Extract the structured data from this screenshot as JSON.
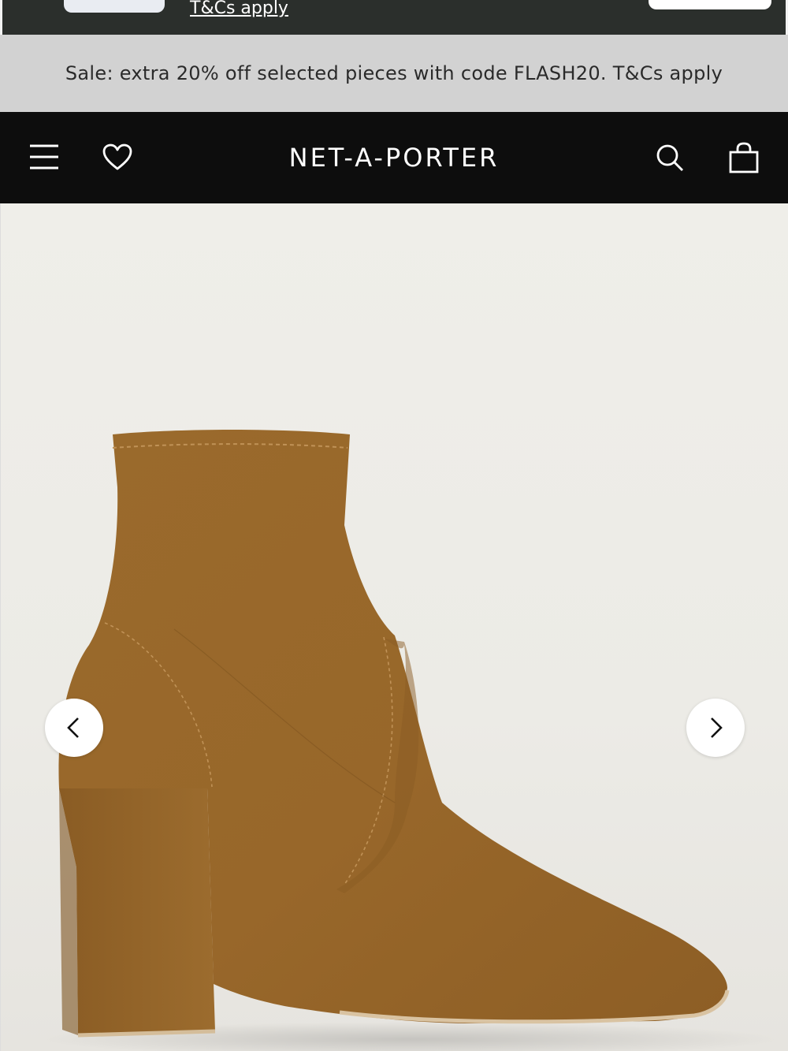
{
  "promo_banner": {
    "link_text": "T&Cs apply"
  },
  "sale_strip": {
    "text": "Sale: extra 20% off selected pieces with code FLASH20. T&Cs apply"
  },
  "header": {
    "logo_text": "NET-A-PORTER",
    "icons": {
      "menu": "menu-icon",
      "wishlist": "heart-icon",
      "search": "search-icon",
      "bag": "shopping-bag-icon"
    }
  },
  "gallery": {
    "product_image": "suede-ankle-boot",
    "prev_icon": "chevron-left-icon",
    "next_icon": "chevron-right-icon"
  },
  "colors": {
    "header_bg": "#0d0d0d",
    "sale_strip_bg": "#d2d2d2",
    "boot_suede": "#9a6a2c"
  }
}
